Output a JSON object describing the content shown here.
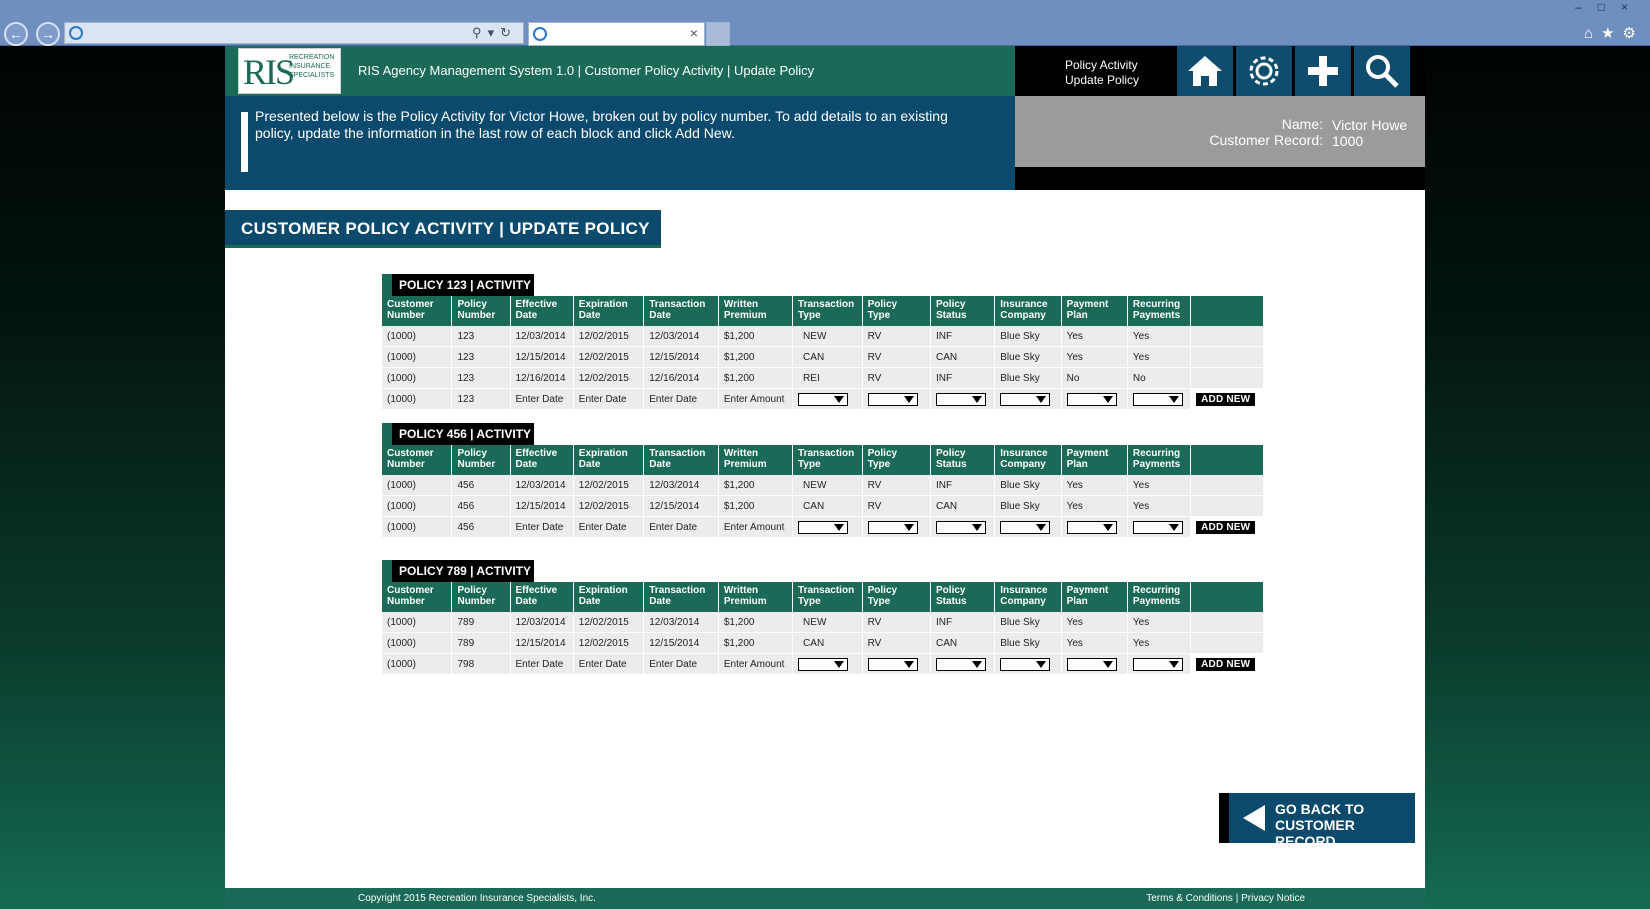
{
  "browser": {
    "address_value": "",
    "tab_title": ""
  },
  "header": {
    "logo_text": "RIS",
    "logo_subtext": "RECREATION INSURANCE SPECIALISTS",
    "app_title": "RIS Agency Management System 1.0 | Customer Policy Activity | Update Policy",
    "crumb_line1": "Policy Activity",
    "crumb_line2": "Update Policy",
    "nav_icons": [
      "home-icon",
      "gear-icon",
      "plus-icon",
      "search-icon"
    ]
  },
  "banner": {
    "message": "Presented below is the Policy Activity for Victor Howe, broken out by policy number. To add details to an existing policy, update the information in the last row of each block and click Add New."
  },
  "customer": {
    "name_label": "Name:",
    "name_value": "Victor Howe",
    "record_label": "Customer Record:",
    "record_value": "1000"
  },
  "section_title": "CUSTOMER POLICY ACTIVITY | UPDATE POLICY",
  "columns": [
    [
      "Customer",
      "Number"
    ],
    [
      "Policy",
      "Number"
    ],
    [
      "Effective",
      "Date"
    ],
    [
      "Expiration",
      "Date"
    ],
    [
      "Transaction",
      "Date"
    ],
    [
      "Written",
      "Premium"
    ],
    [
      "Transaction",
      "Type"
    ],
    [
      "Policy",
      "Type"
    ],
    [
      "Policy",
      "Status"
    ],
    [
      "Insurance",
      "Company"
    ],
    [
      "Payment",
      "Plan"
    ],
    [
      "Recurring",
      "Payments"
    ]
  ],
  "policies": [
    {
      "title": "POLICY 123 | ACTIVITY",
      "rows": [
        [
          "(1000)",
          "123",
          "12/03/2014",
          "12/02/2015",
          "12/03/2014",
          "$1,200",
          "NEW",
          "RV",
          "INF",
          "Blue Sky",
          "Yes",
          "Yes"
        ],
        [
          "(1000)",
          "123",
          "12/15/2014",
          "12/02/2015",
          "12/15/2014",
          "$1,200",
          "CAN",
          "RV",
          "CAN",
          "Blue Sky",
          "Yes",
          "Yes"
        ],
        [
          "(1000)",
          "123",
          "12/16/2014",
          "12/02/2015",
          "12/16/2014",
          "$1,200",
          "REI",
          "RV",
          "INF",
          "Blue Sky",
          "No",
          "No"
        ]
      ],
      "entry": [
        "(1000)",
        "123",
        "Enter Date",
        "Enter Date",
        "Enter Date",
        "Enter Amount"
      ]
    },
    {
      "title": "POLICY 456 | ACTIVITY",
      "rows": [
        [
          "(1000)",
          "456",
          "12/03/2014",
          "12/02/2015",
          "12/03/2014",
          "$1,200",
          "NEW",
          "RV",
          "INF",
          "Blue Sky",
          "Yes",
          "Yes"
        ],
        [
          "(1000)",
          "456",
          "12/15/2014",
          "12/02/2015",
          "12/15/2014",
          "$1,200",
          "CAN",
          "RV",
          "CAN",
          "Blue Sky",
          "Yes",
          "Yes"
        ]
      ],
      "entry": [
        "(1000)",
        "456",
        "Enter Date",
        "Enter Date",
        "Enter Date",
        "Enter Amount"
      ]
    },
    {
      "title": "POLICY 789 | ACTIVITY",
      "rows": [
        [
          "(1000)",
          "789",
          "12/03/2014",
          "12/02/2015",
          "12/03/2014",
          "$1,200",
          "NEW",
          "RV",
          "INF",
          "Blue Sky",
          "Yes",
          "Yes"
        ],
        [
          "(1000)",
          "789",
          "12/15/2014",
          "12/02/2015",
          "12/15/2014",
          "$1,200",
          "CAN",
          "RV",
          "CAN",
          "Blue Sky",
          "Yes",
          "Yes"
        ]
      ],
      "entry": [
        "(1000)",
        "798",
        "Enter Date",
        "Enter Date",
        "Enter Date",
        "Enter Amount"
      ]
    }
  ],
  "add_new_label": "ADD NEW",
  "go_back": {
    "line1": "GO BACK TO",
    "line2": "CUSTOMER RECORD"
  },
  "footer": {
    "copyright": "Copyright 2015 Recreation Insurance Specialists, Inc.",
    "terms": "Terms & Conditions",
    "separator": "|",
    "privacy": "Privacy Notice"
  },
  "colors": {
    "green": "#1a6a57",
    "blue": "#0b4a6d",
    "grey": "#9b9b9b"
  }
}
